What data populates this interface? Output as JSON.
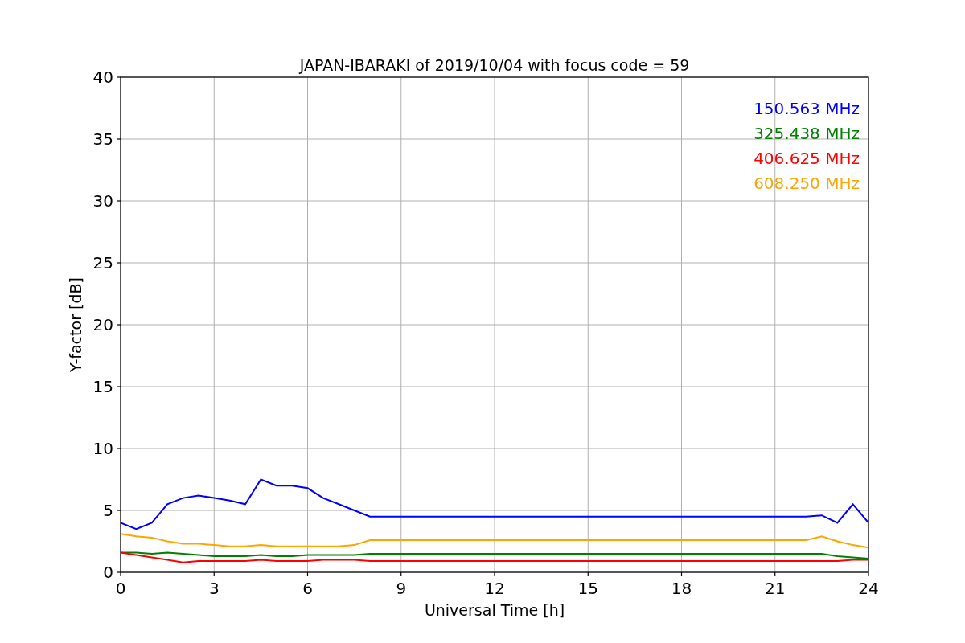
{
  "chart_data": {
    "type": "line",
    "title": "JAPAN-IBARAKI of 2019/10/04 with focus code = 59",
    "xlabel": "Universal Time [h]",
    "ylabel": "Y-factor [dB]",
    "x": [
      0,
      0.5,
      1,
      1.5,
      2,
      2.5,
      3,
      3.5,
      4,
      4.5,
      5,
      5.5,
      6,
      6.5,
      7,
      7.5,
      8,
      22,
      22.5,
      23,
      23.5,
      24
    ],
    "series": [
      {
        "name": "150.563 MHz",
        "color": "#0000ff",
        "values": [
          4,
          3.5,
          4,
          5.5,
          6,
          6.2,
          6,
          5.8,
          5.5,
          7.5,
          7,
          7,
          6.8,
          6,
          5.5,
          5,
          4.5,
          4.5,
          4.6,
          4,
          5.5,
          4
        ]
      },
      {
        "name": "325.438 MHz",
        "color": "#008000",
        "values": [
          1.6,
          1.6,
          1.5,
          1.6,
          1.5,
          1.4,
          1.3,
          1.3,
          1.3,
          1.4,
          1.3,
          1.3,
          1.4,
          1.4,
          1.4,
          1.4,
          1.5,
          1.5,
          1.5,
          1.3,
          1.2,
          1.1
        ]
      },
      {
        "name": "406.625 MHz",
        "color": "#ff0000",
        "values": [
          1.6,
          1.4,
          1.2,
          1,
          0.8,
          0.9,
          0.9,
          0.9,
          0.9,
          1,
          0.9,
          0.9,
          0.9,
          1,
          1,
          1,
          0.9,
          0.9,
          0.9,
          0.9,
          1,
          1
        ]
      },
      {
        "name": "608.250 MHz",
        "color": "#ffa500",
        "values": [
          3.1,
          2.9,
          2.8,
          2.5,
          2.3,
          2.3,
          2.2,
          2.1,
          2.1,
          2.2,
          2.1,
          2.1,
          2.1,
          2.1,
          2.1,
          2.2,
          2.6,
          2.6,
          2.9,
          2.5,
          2.2,
          2
        ]
      }
    ],
    "grid": true,
    "xlim": [
      0,
      24
    ],
    "ylim": [
      0,
      40
    ],
    "xticks": [
      0,
      3,
      6,
      9,
      12,
      15,
      18,
      21,
      24
    ],
    "yticks": [
      0,
      5,
      10,
      15,
      20,
      25,
      30,
      35,
      40
    ]
  }
}
